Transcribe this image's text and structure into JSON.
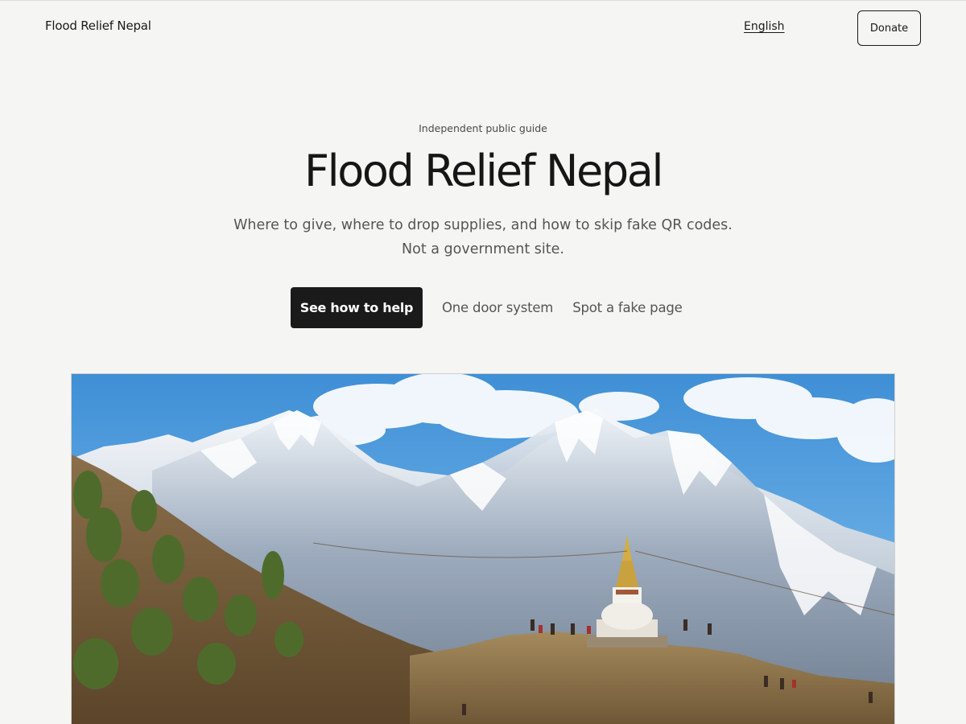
{
  "header": {
    "brand": "Flood Relief Nepal",
    "language": "English",
    "donate_label": "Donate"
  },
  "hero": {
    "eyebrow": "Independent public guide",
    "title": "Flood Relief Nepal",
    "subtitle": "Where to give, where to drop supplies, and how to skip fake QR codes. Not a government site.",
    "primary_cta": "See how to help",
    "links": [
      "One door system",
      "Spot a fake page"
    ]
  },
  "image": {
    "subject": "himalayan-mountains-stupa-photo"
  },
  "colors": {
    "background": "#f5f5f3",
    "primary": "#1a1a1a",
    "muted_text": "#555555"
  }
}
